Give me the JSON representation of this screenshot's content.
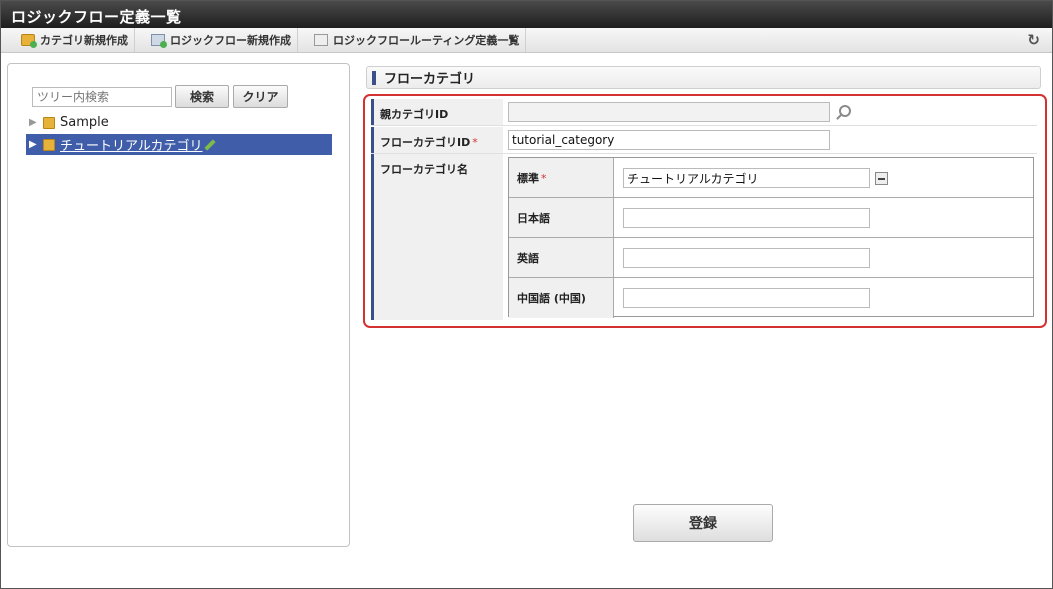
{
  "window": {
    "title": "ロジックフロー定義一覧"
  },
  "toolbar": {
    "new_category": "カテゴリ新規作成",
    "new_flow": "ロジックフロー新規作成",
    "routing_list": "ロジックフロールーティング定義一覧",
    "refresh_icon": "refresh-icon"
  },
  "tree": {
    "search_placeholder": "ツリー内検索",
    "search_button": "検索",
    "clear_button": "クリア",
    "nodes": [
      {
        "label": "Sample"
      },
      {
        "label": "チュートリアルカテゴリ"
      }
    ]
  },
  "form": {
    "section_title": "フローカテゴリ",
    "parent_id_label": "親カテゴリID",
    "parent_id_value": "",
    "category_id_label": "フローカテゴリID",
    "category_id_value": "tutorial_category",
    "category_name_label": "フローカテゴリ名",
    "required_mark": "*",
    "names": [
      {
        "label": "標準",
        "value": "チュートリアルカテゴリ"
      },
      {
        "label": "日本語",
        "value": ""
      },
      {
        "label": "英語",
        "value": ""
      },
      {
        "label": "中国語 (中国)",
        "value": ""
      }
    ],
    "register_button": "登録"
  },
  "colors": {
    "accent": "#3a4f8a",
    "selected": "#3f5da8",
    "highlight": "#d43131"
  }
}
